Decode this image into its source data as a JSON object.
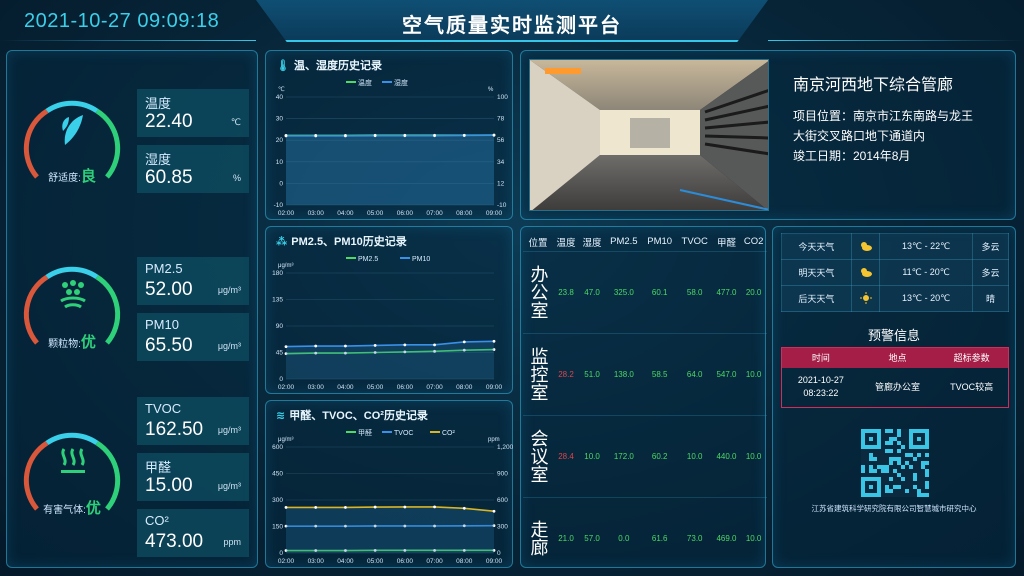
{
  "header": {
    "datetime": "2021-10-27 09:09:18",
    "title": "空气质量实时监测平台"
  },
  "left": {
    "groups": [
      {
        "label": "舒适度:",
        "status": "良",
        "icon": "leaf-icon",
        "metrics": [
          {
            "name": "温度",
            "value": "22.40",
            "unit": "℃"
          },
          {
            "name": "湿度",
            "value": "60.85",
            "unit": "%"
          }
        ]
      },
      {
        "label": "颗粒物:",
        "status": "优",
        "icon": "particles-icon",
        "metrics": [
          {
            "name": "PM2.5",
            "value": "52.00",
            "unit": "μg/m³"
          },
          {
            "name": "PM10",
            "value": "65.50",
            "unit": "μg/m³"
          }
        ]
      },
      {
        "label": "有害气体:",
        "status": "优",
        "icon": "gas-wave-icon",
        "metrics": [
          {
            "name": "TVOC",
            "value": "162.50",
            "unit": "μg/m³"
          },
          {
            "name": "甲醛",
            "value": "15.00",
            "unit": "μg/m³"
          },
          {
            "name": "CO²",
            "value": "473.00",
            "unit": "ppm"
          }
        ]
      }
    ],
    "colors": {
      "good": "#2fd07a",
      "accent": "#3ad0ea",
      "warn": "#d9573a"
    }
  },
  "chart_data": [
    {
      "type": "line",
      "title": "温、湿度历史记录",
      "x": [
        "02:00",
        "03:00",
        "04:00",
        "05:00",
        "06:00",
        "07:00",
        "08:00",
        "09:00"
      ],
      "left_unit": "℃",
      "right_unit": "%",
      "left_ticks": [
        "40",
        "30",
        "20",
        "10",
        "0",
        "-10"
      ],
      "right_ticks": [
        "100",
        "78",
        "56",
        "34",
        "12",
        "-10"
      ],
      "ylim": [
        -10,
        40
      ],
      "y2lim": [
        -10,
        100
      ],
      "series": [
        {
          "name": "温度",
          "color": "#4cd964",
          "axis": "left",
          "values": [
            22.2,
            22.2,
            22.2,
            22.3,
            22.3,
            22.3,
            22.3,
            22.4
          ]
        },
        {
          "name": "湿度",
          "color": "#3a8fe8",
          "axis": "left",
          "values": [
            22.0,
            22.0,
            22.0,
            22.1,
            22.1,
            22.1,
            22.2,
            22.3
          ]
        }
      ]
    },
    {
      "type": "line",
      "title": "PM2.5、PM10历史记录",
      "x": [
        "02:00",
        "03:00",
        "04:00",
        "05:00",
        "06:00",
        "07:00",
        "08:00",
        "09:00"
      ],
      "left_unit": "μg/m³",
      "left_ticks": [
        "180",
        "135",
        "90",
        "45",
        "0"
      ],
      "ylim": [
        0,
        180
      ],
      "series": [
        {
          "name": "PM2.5",
          "color": "#4cd964",
          "axis": "left",
          "values": [
            43,
            44,
            44,
            45,
            46,
            47,
            49,
            50
          ]
        },
        {
          "name": "PM10",
          "color": "#3a8fe8",
          "axis": "left",
          "values": [
            55,
            56,
            56,
            57,
            58,
            58,
            63,
            64
          ]
        }
      ]
    },
    {
      "type": "line",
      "title": "甲醛、TVOC、CO²历史记录",
      "x": [
        "02:00",
        "03:00",
        "04:00",
        "05:00",
        "06:00",
        "07:00",
        "08:00",
        "09:00"
      ],
      "left_unit": "μg/m³",
      "right_unit": "ppm",
      "left_ticks": [
        "600",
        "450",
        "300",
        "150",
        "0"
      ],
      "right_ticks": [
        "1,200",
        "900",
        "600",
        "300",
        "0"
      ],
      "ylim": [
        0,
        600
      ],
      "y2lim": [
        0,
        1200
      ],
      "series": [
        {
          "name": "甲醛",
          "color": "#4cd964",
          "axis": "left",
          "values": [
            14,
            14,
            14,
            15,
            15,
            15,
            15,
            15
          ]
        },
        {
          "name": "TVOC",
          "color": "#3a8fe8",
          "axis": "left",
          "values": [
            152,
            152,
            152,
            153,
            153,
            153,
            154,
            155
          ]
        },
        {
          "name": "CO²",
          "color": "#d9b426",
          "axis": "right",
          "values": [
            516,
            516,
            516,
            520,
            521,
            522,
            506,
            473
          ]
        }
      ]
    }
  ],
  "site": {
    "name": "南京河西地下综合管廊",
    "location_line1": "项目位置：南京市江东南路与龙王",
    "location_line2": "大街交叉路口地下通道内",
    "completion": "竣工日期：2014年8月"
  },
  "position_table": {
    "headers": [
      "位置",
      "温度",
      "湿度",
      "PM2.5",
      "PM10",
      "TVOC",
      "甲醛",
      "CO2"
    ],
    "rows": [
      {
        "loc": "办公室",
        "cells": [
          "23.8",
          "47.0",
          "325.0",
          "60.1",
          "58.0",
          "477.0",
          "20.0"
        ],
        "alert": false
      },
      {
        "loc": "监控室",
        "cells": [
          "28.2",
          "51.0",
          "138.0",
          "58.5",
          "64.0",
          "547.0",
          "10.0"
        ],
        "alert": true
      },
      {
        "loc": "会议室",
        "cells": [
          "28.4",
          "10.0",
          "172.0",
          "60.2",
          "10.0",
          "440.0",
          "10.0"
        ],
        "alert": true
      },
      {
        "loc": "走廊",
        "cells": [
          "21.0",
          "57.0",
          "0.0",
          "61.6",
          "73.0",
          "469.0",
          "10.0"
        ],
        "alert": false
      }
    ]
  },
  "weather": [
    {
      "day": "今天天气",
      "icon": "partly-cloudy-icon",
      "temp": "13℃ - 22℃",
      "desc": "多云"
    },
    {
      "day": "明天天气",
      "icon": "partly-cloudy-icon",
      "temp": "11℃ - 20℃",
      "desc": "多云"
    },
    {
      "day": "后天天气",
      "icon": "sun-icon",
      "temp": "13℃ - 20℃",
      "desc": "晴"
    }
  ],
  "warning": {
    "title": "预警信息",
    "headers": [
      "时间",
      "地点",
      "超标参数"
    ],
    "row": {
      "time1": "2021-10-27",
      "time2": "08:23:22",
      "place": "管廊办公室",
      "param": "TVOC较高"
    }
  },
  "org": "江苏省建筑科学研究院有限公司智慧城市研究中心"
}
